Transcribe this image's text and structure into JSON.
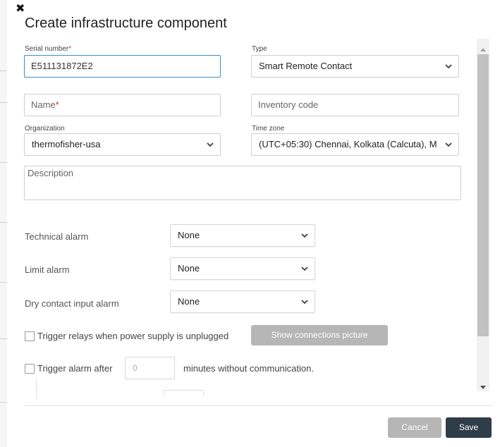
{
  "dialog": {
    "title": "Create infrastructure component",
    "close_icon": "close-icon"
  },
  "fields": {
    "serial_number": {
      "label": "Serial number",
      "required_mark": "*",
      "value": "E511131872E2"
    },
    "type": {
      "label": "Type",
      "value": "Smart Remote Contact"
    },
    "name": {
      "placeholder": "Name",
      "required_mark": "*"
    },
    "inventory_code": {
      "placeholder": "Inventory code"
    },
    "organization": {
      "label": "Organization",
      "value": "thermofisher-usa"
    },
    "time_zone": {
      "label": "Time zone",
      "value": "(UTC+05:30) Chennai, Kolkata (Calcuta), M"
    },
    "description": {
      "placeholder": "Description"
    }
  },
  "alarms": {
    "technical": {
      "label": "Technical alarm",
      "value": "None"
    },
    "limit": {
      "label": "Limit alarm",
      "value": "None"
    },
    "dry_contact": {
      "label": "Dry contact input alarm",
      "value": "None"
    }
  },
  "options": {
    "trigger_relays_label": "Trigger relays when power supply is unplugged",
    "show_connections_label": "Show connections picture",
    "trigger_alarm_label": "Trigger alarm after",
    "minutes_placeholder": "0",
    "minutes_suffix": "minutes without communication."
  },
  "footer": {
    "cancel_label": "Cancel",
    "save_label": "Save"
  },
  "colors": {
    "accent": "#3c8dc4",
    "save_button": "#2f3d48",
    "disabled_button": "#b6b6b6",
    "required": "#c0392b"
  }
}
